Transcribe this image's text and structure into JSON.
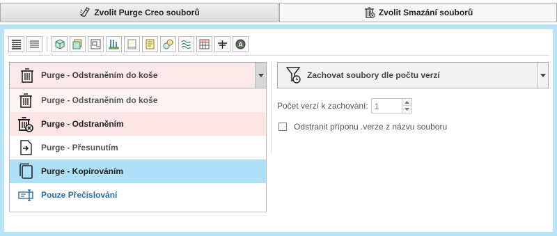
{
  "tabs": [
    {
      "label": "Zvolit Purge Creo souborů",
      "icon": "purge-brush-icon"
    },
    {
      "label": "Zvolit Smazání souborů",
      "icon": "trash-icon"
    }
  ],
  "colors": {
    "panel_bg": "#b9e4f8",
    "selected_row": "#aee0f9",
    "danger_row": "#fde5e5",
    "link_blue": "#2a6ea6"
  },
  "toolbar": {
    "buttons": [
      "list-view-detail-icon",
      "list-view-icon",
      "cube-icon",
      "layered-part-icon",
      "drawing-icon",
      "assembly-icon",
      "blank-sheet-icon",
      "notebook-icon",
      "family-table-icon",
      "pattern-icon",
      "table-icon",
      "layer-icon",
      "format-icon"
    ]
  },
  "purge_mode": {
    "selected": "Purge - Odstraněním do koše",
    "options": [
      {
        "label": "Purge - Odstraněním do koše",
        "icon": "trash-icon"
      },
      {
        "label": "Purge - Odstraněním",
        "icon": "trash-delete-icon"
      },
      {
        "label": "Purge - Přesunutím",
        "icon": "file-move-icon"
      },
      {
        "label": "Purge - Kopírováním",
        "icon": "copy-icon"
      },
      {
        "label": "Pouze Přečíslování",
        "icon": "renumber-icon"
      }
    ]
  },
  "version_mode": {
    "selected": "Zachovat soubory dle počtu verzí",
    "icon": "filter-clock-icon"
  },
  "keep_count": {
    "label": "Počet verzí k zachování:",
    "value": "1"
  },
  "remove_suffix": {
    "label": "Odstranit příponu .verze z názvu souboru",
    "checked": false
  }
}
